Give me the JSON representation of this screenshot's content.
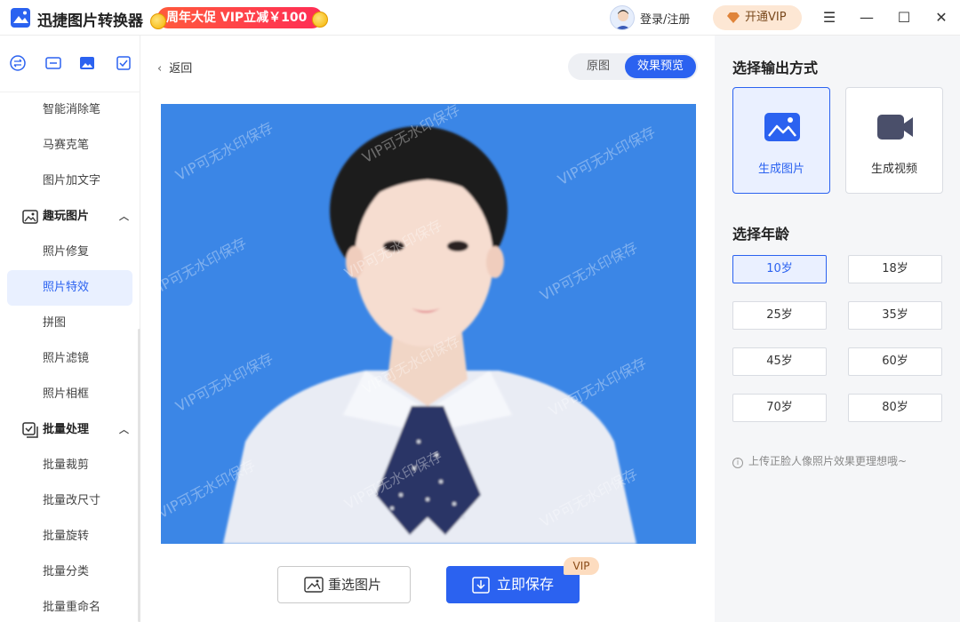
{
  "window": {
    "app_title": "迅捷图片转换器",
    "promo": "周年大促 VIP立减￥100",
    "login": "登录/注册",
    "vip_button": "开通VIP",
    "controls": {
      "menu": "☰",
      "minimize": "—",
      "maximize": "☐",
      "close": "✕"
    }
  },
  "sidebar": {
    "top_icons": [
      "convert-icon",
      "id-card-icon",
      "image-icon",
      "checklist-icon"
    ],
    "items": [
      {
        "label": "智能消除笔",
        "type": "item"
      },
      {
        "label": "马赛克笔",
        "type": "item"
      },
      {
        "label": "图片加文字",
        "type": "item"
      },
      {
        "label": "趣玩图片",
        "type": "group"
      },
      {
        "label": "照片修复",
        "type": "item"
      },
      {
        "label": "照片特效",
        "type": "item",
        "active": true
      },
      {
        "label": "拼图",
        "type": "item"
      },
      {
        "label": "照片滤镜",
        "type": "item"
      },
      {
        "label": "照片相框",
        "type": "item"
      },
      {
        "label": "批量处理",
        "type": "group"
      },
      {
        "label": "批量裁剪",
        "type": "item"
      },
      {
        "label": "批量改尺寸",
        "type": "item"
      },
      {
        "label": "批量旋转",
        "type": "item"
      },
      {
        "label": "批量分类",
        "type": "item"
      },
      {
        "label": "批量重命名",
        "type": "item"
      }
    ]
  },
  "main": {
    "back_label": "返回",
    "toggle": {
      "original": "原图",
      "preview": "效果预览",
      "selected": "效果预览"
    },
    "watermark_text": "VIP可无水印保存",
    "reselect_label": "重选图片",
    "save_label": "立即保存",
    "vip_tag": "VIP"
  },
  "panel": {
    "output_title": "选择输出方式",
    "outputs": [
      {
        "label": "生成图片",
        "icon": "image-icon",
        "selected": true
      },
      {
        "label": "生成视频",
        "icon": "video-camera-icon",
        "selected": false
      }
    ],
    "age_title": "选择年龄",
    "ages": [
      "10岁",
      "18岁",
      "25岁",
      "35岁",
      "45岁",
      "60岁",
      "70岁",
      "80岁"
    ],
    "selected_age": "10岁",
    "hint": "上传正脸人像照片效果更理想哦~"
  },
  "colors": {
    "accent": "#2b62f0",
    "photo_bg": "#3b86e6",
    "promo": "#ff3b4a",
    "panel_bg": "#f5f6f8"
  }
}
